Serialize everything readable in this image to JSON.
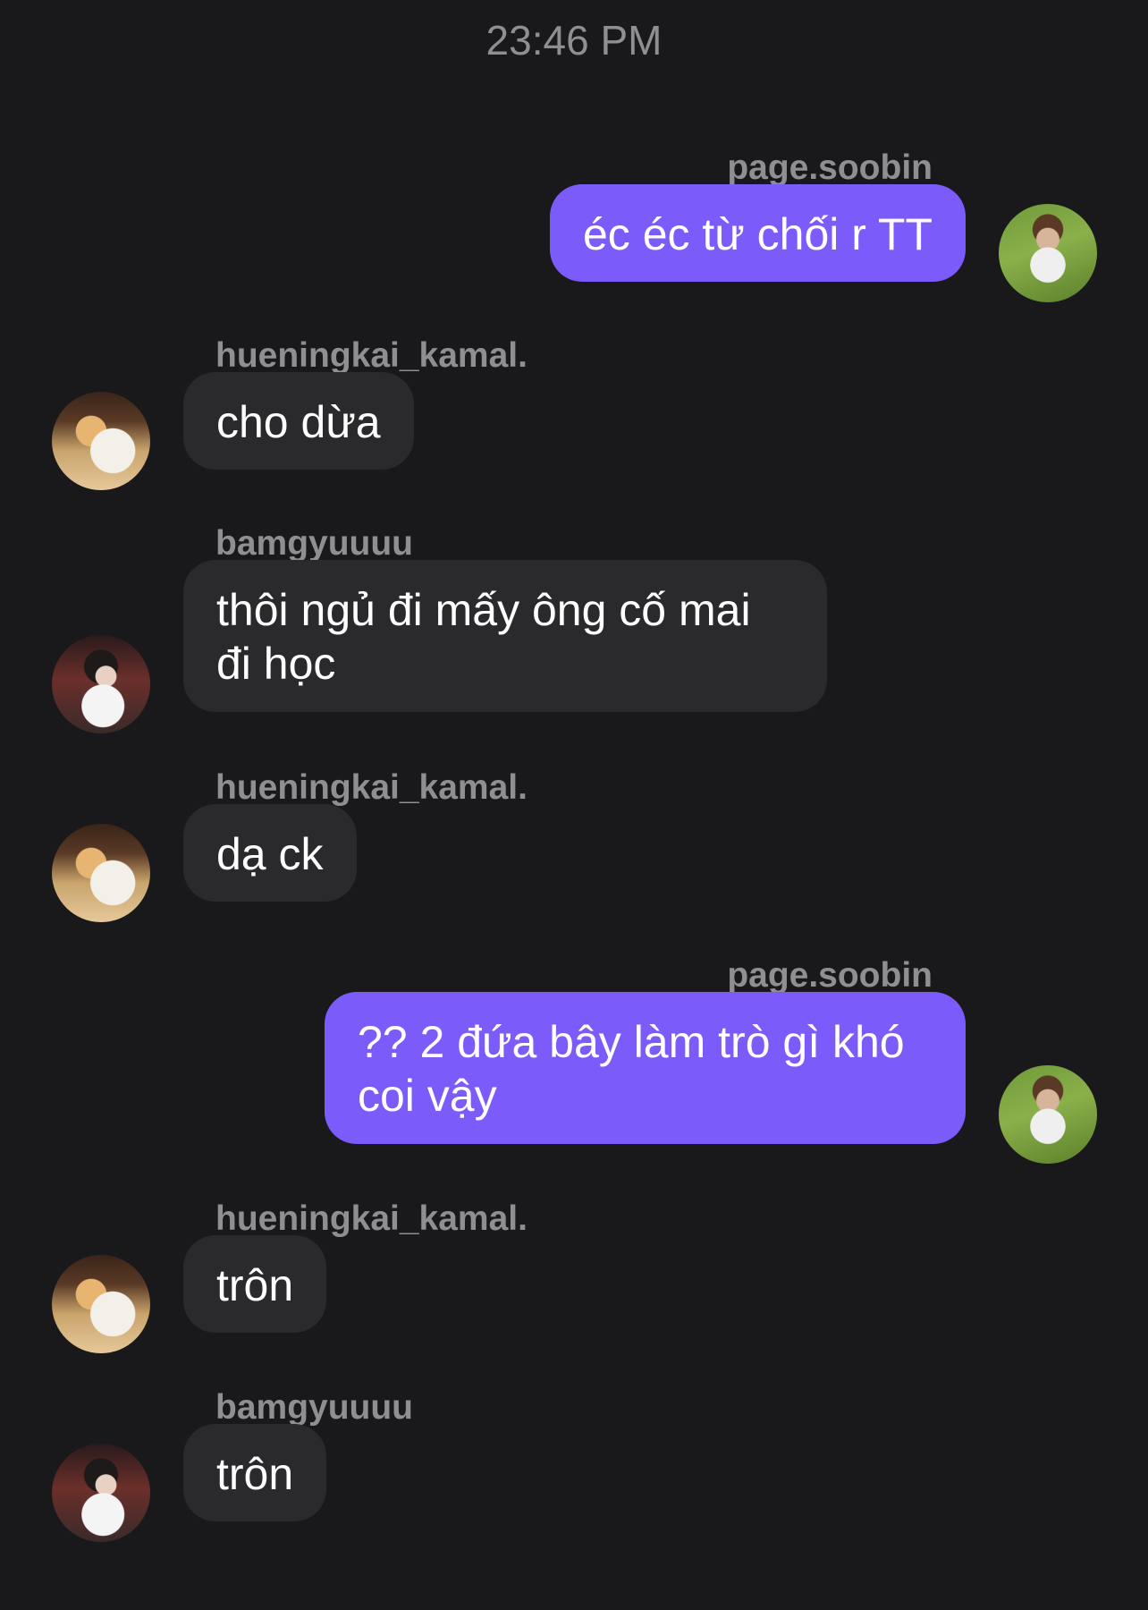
{
  "header": {
    "timestamp": "23:46 PM"
  },
  "messages": [
    {
      "sender": "page.soobin",
      "text": "éc éc từ chối r TT",
      "direction": "out",
      "avatar": "avatar-page-soobin"
    },
    {
      "sender": "hueningkai_kamal.",
      "text": "cho dừa",
      "direction": "in",
      "avatar": "avatar-hueningkai-kamal"
    },
    {
      "sender": "bamgyuuuu",
      "text": "thôi ngủ đi mấy ông cố mai đi học",
      "direction": "in",
      "avatar": "avatar-bamgyuuuu"
    },
    {
      "sender": "hueningkai_kamal.",
      "text": "dạ ck",
      "direction": "in",
      "avatar": "avatar-hueningkai-kamal"
    },
    {
      "sender": "page.soobin",
      "text": "?? 2 đứa bây làm trò gì khó coi vậy",
      "direction": "out",
      "avatar": "avatar-page-soobin"
    },
    {
      "sender": "hueningkai_kamal.",
      "text": "trôn",
      "direction": "in",
      "avatar": "avatar-hueningkai-kamal"
    },
    {
      "sender": "bamgyuuuu",
      "text": "trôn",
      "direction": "in",
      "avatar": "avatar-bamgyuuuu"
    }
  ],
  "colors": {
    "background": "#19191b",
    "outgoing_bubble": "#7b5cfa",
    "incoming_bubble": "#2a2a2d",
    "sender_label": "#8e8e93"
  }
}
